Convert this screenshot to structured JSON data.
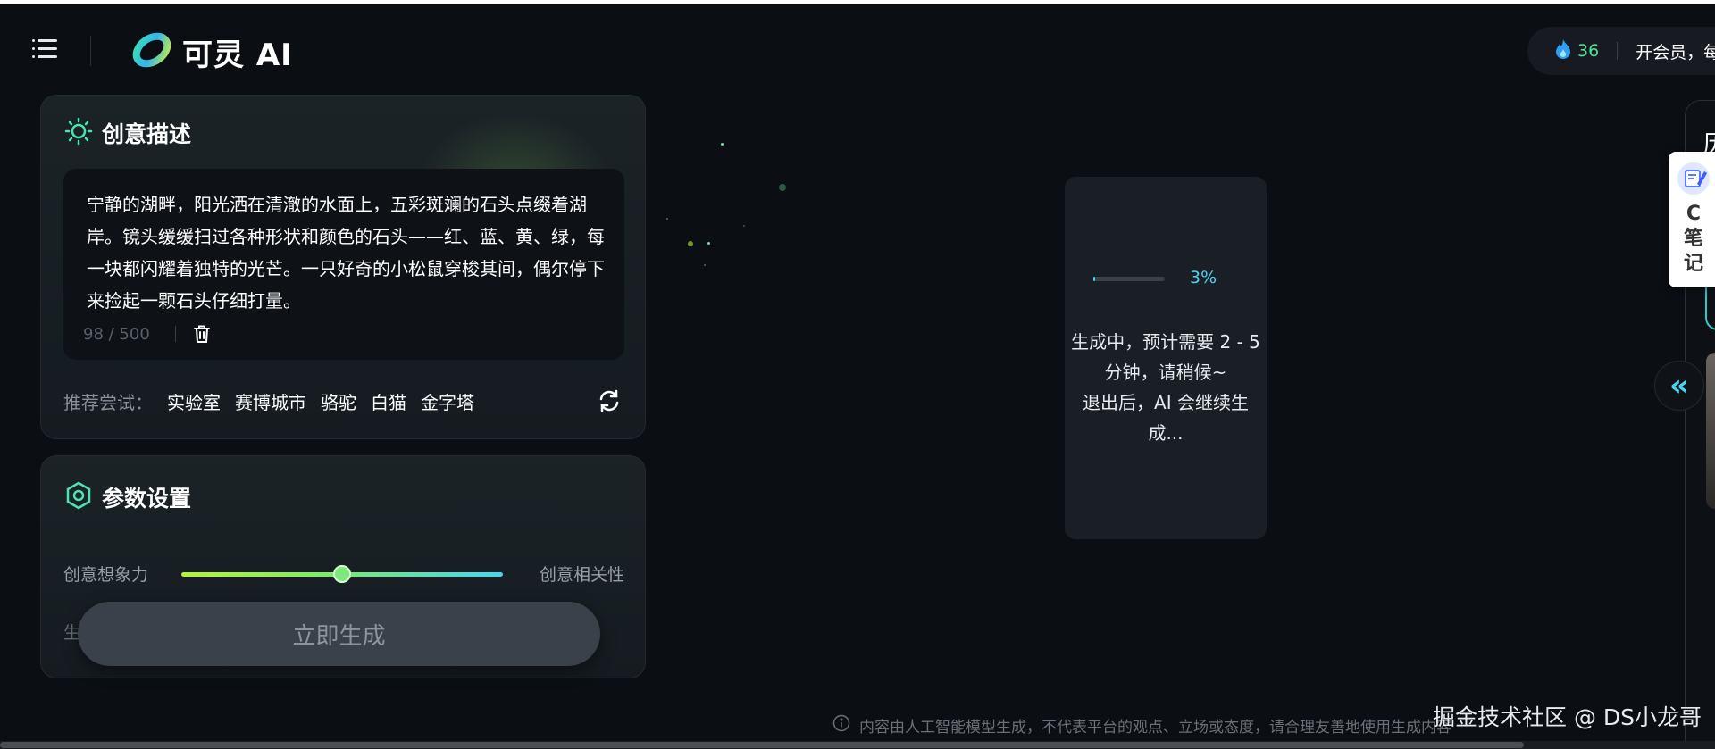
{
  "header": {
    "brand": "可灵 AI",
    "points": "36",
    "vip_text": "开会员，每",
    "icons": [
      "menu-icon",
      "kling-logo-icon",
      "flame-icon"
    ]
  },
  "prompt_card": {
    "title": "创意描述",
    "text": "宁静的湖畔，阳光洒在清澈的水面上，五彩斑斓的石头点缀着湖岸。镜头缓缓扫过各种形状和颜色的石头——红、蓝、黄、绿，每一块都闪耀着独特的光芒。一只好奇的小松鼠穿梭其间，偶尔停下来捡起一颗石头仔细打量。",
    "char_count": "98 / 500",
    "suggest_label": "推荐尝试：",
    "suggestions": [
      "实验室",
      "赛博城市",
      "骆驼",
      "白猫",
      "金字塔"
    ],
    "icons": [
      "sun-icon",
      "trash-icon",
      "refresh-icon"
    ]
  },
  "params_card": {
    "title": "参数设置",
    "slider_left": "创意想象力",
    "slider_right": "创意相关性",
    "slider_value": 0.5,
    "hidden_label": "生",
    "icons": [
      "hexagon-icon"
    ]
  },
  "generate_button": "立即生成",
  "progress": {
    "percent": "3%",
    "fraction": 0.03,
    "message_line1": "生成中，预计需要 2 - 5 分钟，请稍候~",
    "message_line2": "退出后，AI 会继续生成..."
  },
  "right_panel": {
    "glyph": "历",
    "collapse_glyph": "«"
  },
  "note_widget": {
    "label": "C\n笔\n记",
    "icons": [
      "note-pen-icon"
    ]
  },
  "footer": {
    "disclaimer": "内容由人工智能模型生成，不代表平台的观点、立场或态度，请合理友善地使用生成内容",
    "watermark": "掘金技术社区 @ DS小龙哥",
    "icons": [
      "info-icon"
    ]
  },
  "colors": {
    "accent_cyan": "#4ad3f0",
    "accent_green": "#4be39a",
    "background": "#0b0e13"
  }
}
